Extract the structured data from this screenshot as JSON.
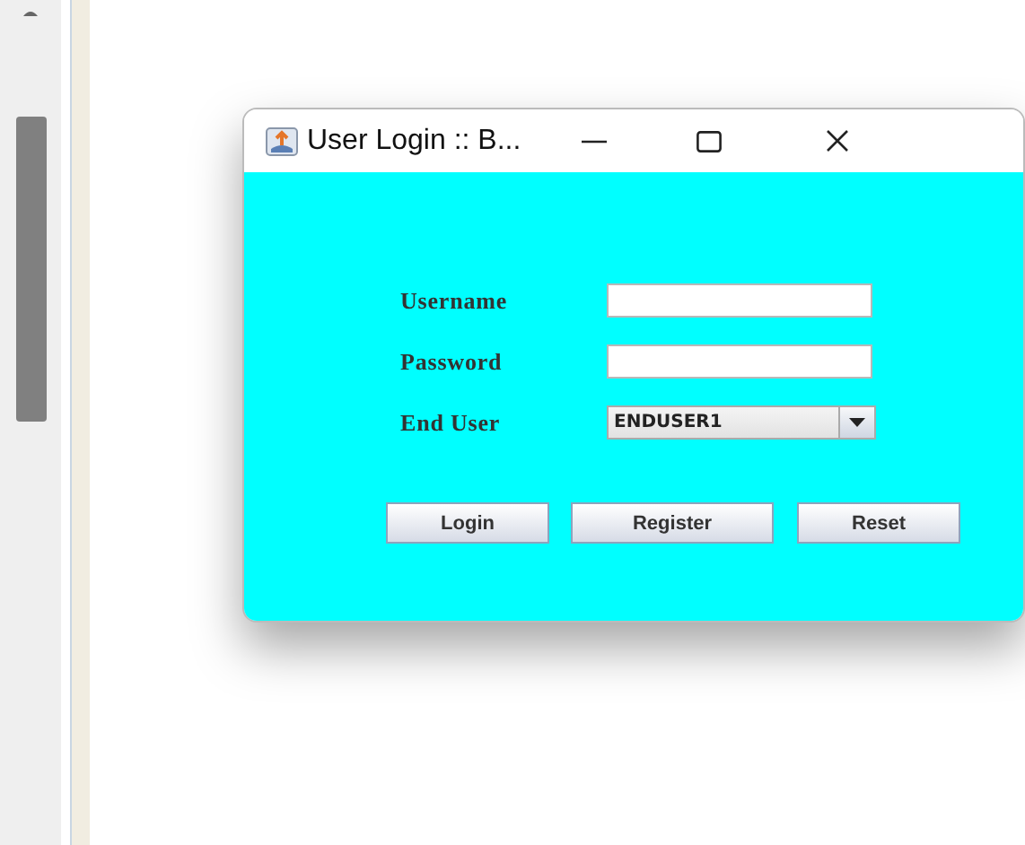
{
  "window": {
    "title": "User Login :: B..."
  },
  "fields": [
    {
      "kind": "text",
      "label": "Username"
    },
    {
      "kind": "password",
      "label": "Password"
    },
    {
      "kind": "select",
      "label": "End User",
      "value": "ENDUSER1"
    }
  ],
  "buttons": [
    "Login",
    "Register",
    "Reset"
  ]
}
